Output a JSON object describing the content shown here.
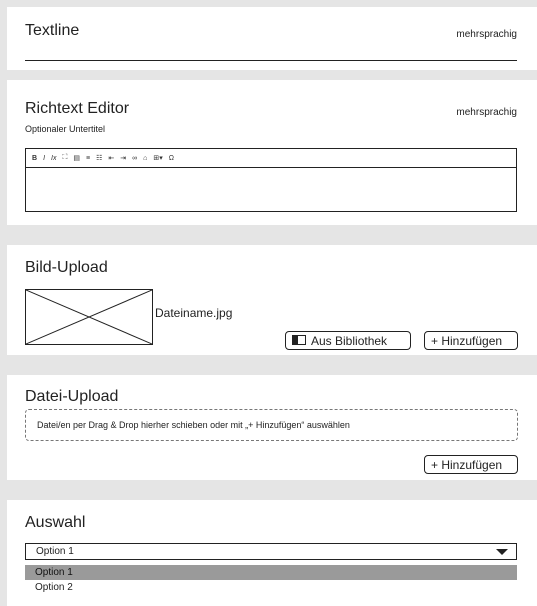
{
  "textline": {
    "title": "Textline",
    "badge": "mehrsprachig"
  },
  "richtext": {
    "title": "Richtext Editor",
    "subtitle": "Optionaler Untertitel",
    "badge": "mehrsprachig",
    "toolbar": [
      "B",
      "I",
      "Ix",
      "⛶",
      "▤",
      "≡",
      "☷",
      "⇤",
      "⇥",
      "∞",
      "⌂",
      "⊞▾",
      "Ω"
    ]
  },
  "image_upload": {
    "title": "Bild-Upload",
    "filename": "Dateiname.jpg",
    "library_button": "Aus Bibliothek",
    "add_button": "+ Hinzufügen"
  },
  "file_upload": {
    "title": "Datei-Upload",
    "dropzone_text": "Datei/en per Drag & Drop hierher schieben oder mit „+ Hinzufügen“ auswählen",
    "add_button": "+ Hinzufügen"
  },
  "select": {
    "title": "Auswahl",
    "selected": "Option 1",
    "options": [
      "Option 1",
      "Option 2"
    ]
  }
}
